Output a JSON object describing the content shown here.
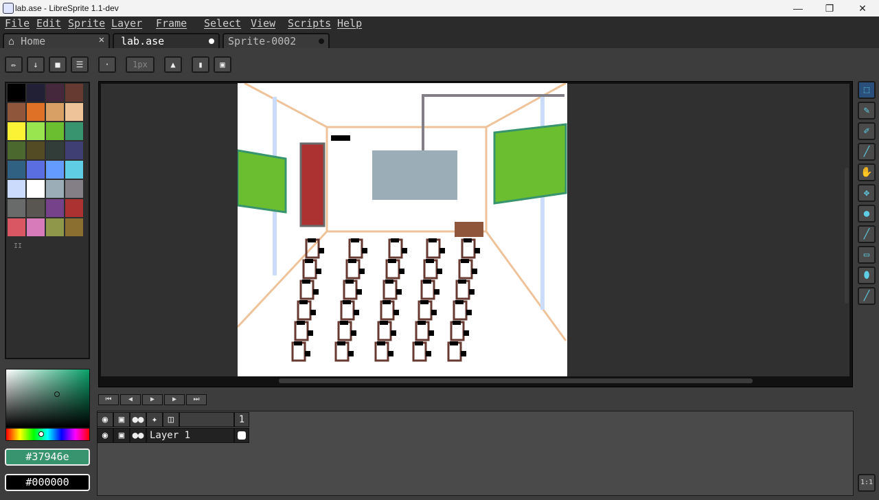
{
  "window": {
    "title": "lab.ase - LibreSprite 1.1-dev",
    "minimize": "—",
    "maximize": "❐",
    "close": "✕"
  },
  "menu": [
    "File",
    "Edit",
    "Sprite",
    "Layer",
    "Frame",
    "Select",
    "View",
    "Scripts",
    "Help"
  ],
  "tabs": [
    {
      "label": "Home",
      "icon": "home-icon"
    },
    {
      "label": "lab.ase"
    },
    {
      "label": "Sprite-0002"
    }
  ],
  "toolbar": {
    "brush_size": "1px"
  },
  "colors": {
    "foreground_hex": "#37946e",
    "background_hex": "#000000",
    "accent": "#37946e"
  },
  "palette": [
    "#000000",
    "#222034",
    "#45283c",
    "#663931",
    "#8f563b",
    "#df7126",
    "#d9a066",
    "#eec39a",
    "#fbf236",
    "#99e550",
    "#6abe30",
    "#37946e",
    "#4b692f",
    "#524b24",
    "#323c39",
    "#3f3f74",
    "#306082",
    "#5b6ee1",
    "#639bff",
    "#5fcde4",
    "#cbdbfc",
    "#ffffff",
    "#9badb7",
    "#847e87",
    "#696a6a",
    "#595652",
    "#76428a",
    "#ac3232",
    "#d95763",
    "#d77bba",
    "#8f974a",
    "#8a6f30"
  ],
  "timeline": {
    "frame_number": "1",
    "layer_name": "Layer 1"
  },
  "zoom_button": "1:1",
  "tools": [
    "marquee-icon",
    "pencil-icon",
    "eraser-icon",
    "eyedropper-icon",
    "hand-icon",
    "move-icon",
    "paint-bucket-icon",
    "line-icon",
    "rectangle-icon",
    "blob-icon",
    "spray-icon"
  ]
}
